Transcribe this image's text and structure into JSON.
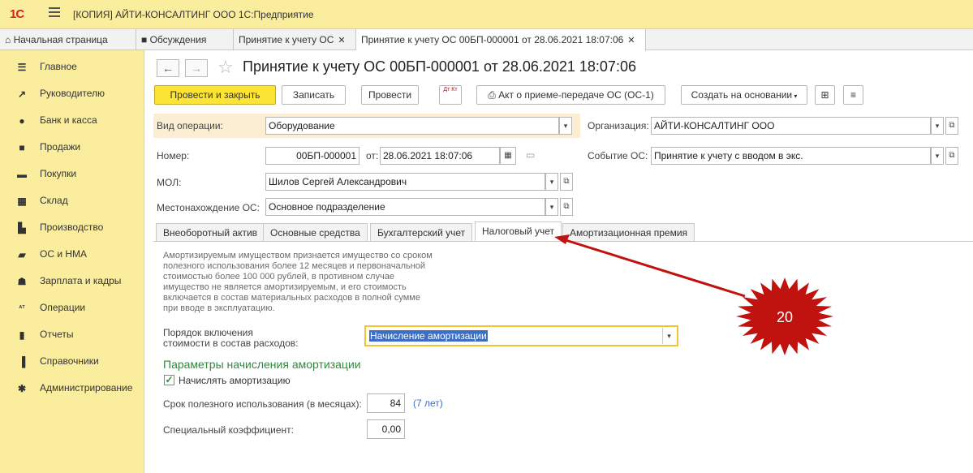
{
  "app": {
    "title": "[КОПИЯ] АЙТИ-КОНСАЛТИНГ ООО 1С:Предприятие",
    "logo": "1С"
  },
  "top_tabs": [
    {
      "label": "Начальная страница",
      "icon": "home-icon"
    },
    {
      "label": "Обсуждения",
      "icon": "chat-icon"
    },
    {
      "label": "Принятие к учету ОС"
    },
    {
      "label": "Принятие к учету ОС 00БП-000001 от 28.06.2021 18:07:06"
    }
  ],
  "sidebar": {
    "items": [
      {
        "label": "Главное",
        "icon": "list-icon"
      },
      {
        "label": "Руководителю",
        "icon": "trend-icon"
      },
      {
        "label": "Банк и касса",
        "icon": "coin-icon"
      },
      {
        "label": "Продажи",
        "icon": "bag-icon"
      },
      {
        "label": "Покупки",
        "icon": "cart-icon"
      },
      {
        "label": "Склад",
        "icon": "warehouse-icon"
      },
      {
        "label": "Производство",
        "icon": "factory-icon"
      },
      {
        "label": "ОС и НМА",
        "icon": "truck-icon"
      },
      {
        "label": "Зарплата и кадры",
        "icon": "person-icon"
      },
      {
        "label": "Операции",
        "icon": "dt-kt-icon"
      },
      {
        "label": "Отчеты",
        "icon": "bar-chart-icon"
      },
      {
        "label": "Справочники",
        "icon": "book-icon"
      },
      {
        "label": "Администрирование",
        "icon": "gear-icon"
      }
    ]
  },
  "document": {
    "title": "Принятие к учету ОС 00БП-000001 от 28.06.2021 18:07:06"
  },
  "toolbar": {
    "post_close": "Провести и закрыть",
    "save": "Записать",
    "post": "Провести",
    "dtkt": "Дт Кт",
    "act": "Акт о приеме-передаче ОС (ОС-1)",
    "create_based": "Создать на основании"
  },
  "form": {
    "vid_label": "Вид операции:",
    "vid_value": "Оборудование",
    "org_label": "Организация:",
    "org_value": "АЙТИ-КОНСАЛТИНГ ООО",
    "number_label": "Номер:",
    "number_value": "00БП-000001",
    "date_label": "от:",
    "date_value": "28.06.2021 18:07:06",
    "event_label": "Событие ОС:",
    "event_value": "Принятие к учету с вводом в экс.",
    "mol_label": "МОЛ:",
    "mol_value": "Шилов Сергей Александрович",
    "location_label": "Местонахождение ОС:",
    "location_value": "Основное подразделение"
  },
  "form_tabs": [
    "Внеоборотный актив",
    "Основные средства",
    "Бухгалтерский учет",
    "Налоговый учет",
    "Амортизационная премия"
  ],
  "tax": {
    "info_lines": [
      "Амортизируемым имуществом признается имущество со сроком",
      "полезного использования более 12 месяцев и первоначальной",
      "стоимостью более 100 000 рублей, в противном случае",
      "имущество не является амортизируемым, и его стоимость",
      "включается в состав материальных расходов в полной сумме",
      "при вводе в эксплуатацию."
    ],
    "order_label_1": "Порядок включения",
    "order_label_2": "стоимости в состав расходов:",
    "order_value": "Начисление амортизации",
    "section_title": "Параметры начисления амортизации",
    "accrue_label": "Начислять амортизацию",
    "accrue_checked": true,
    "term_label": "Срок полезного использования (в месяцах):",
    "term_value": "84",
    "term_years": "(7 лет)",
    "coef_label": "Специальный коэффициент:",
    "coef_value": "0,00"
  },
  "annotation": {
    "badge_number": "20",
    "badge_color": "#c0130f",
    "arrow_color": "#c0130f"
  }
}
